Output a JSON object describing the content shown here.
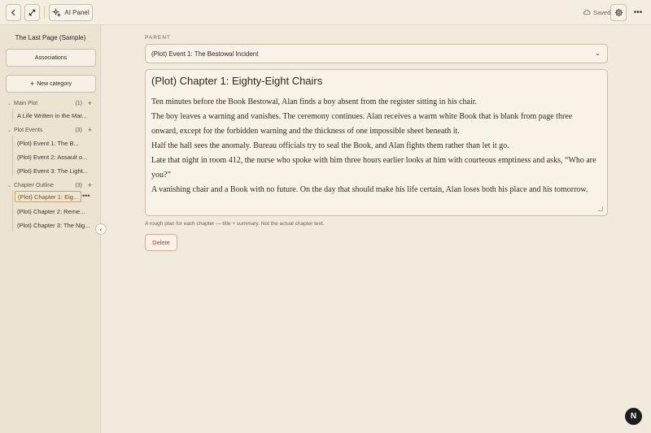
{
  "toolbar": {
    "ai_panel_label": "AI Panel",
    "saved_label": "Saved"
  },
  "sidebar": {
    "title": "The Last Page (Sample)",
    "associations_label": "Associations",
    "new_category_label": "New category",
    "categories": [
      {
        "name": "Main Plot",
        "count": "(1)",
        "items": [
          "A Life Written in the Mar..."
        ]
      },
      {
        "name": "Plot Events",
        "count": "(3)",
        "items": [
          "(Plot) Event 1: The B...",
          "(Plot) Event 2: Assault o...",
          "(Plot) Event 3: The Light..."
        ]
      },
      {
        "name": "Chapter Outline",
        "count": "(3)",
        "items": [
          "(Plot) Chapter 1: Eig...",
          "(Plot) Chapter 2: Reme...",
          "(Plot) Chapter 3: The Nig..."
        ]
      }
    ]
  },
  "main": {
    "parent_label": "PARENT",
    "parent_value": "(Plot) Event 1: The Bestowal Incident",
    "title": "(Plot) Chapter 1: Eighty-Eight Chairs",
    "paragraphs": [
      "Ten minutes before the Book Bestowal, Alan finds a boy absent from the register sitting in his chair.",
      "The boy leaves a warning and vanishes. The ceremony continues. Alan receives a warm white Book that is blank from page three onward, except for the forbidden warning and the thickness of one impossible sheet beneath it.",
      "Half the hall sees the anomaly. Bureau officials try to seal the Book, and Alan fights them rather than let it go.",
      "Late that night in room 412, the nurse who spoke with him three hours earlier looks at him with courteous emptiness and asks, “Who are you?”",
      "A vanishing chair and a Book with no future. On the day that should make his life certain, Alan loses both his place and his tomorrow."
    ],
    "hint": "A rough plan for each chapter — title + summary. Not the actual chapter text.",
    "delete_label": "Delete"
  },
  "badge": {
    "letter": "N"
  }
}
